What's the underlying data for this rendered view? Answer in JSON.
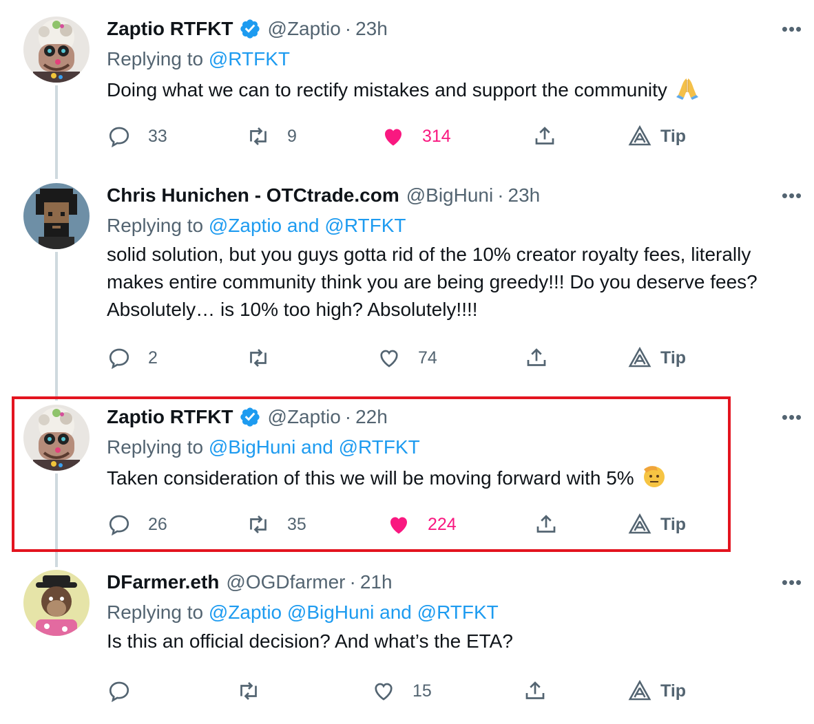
{
  "tweets": [
    {
      "name": "Zaptio RTFKT",
      "verified": true,
      "handle": "@Zaptio",
      "sep": "·",
      "time": "23h",
      "replying_prefix": "Replying to",
      "replying_to": "@RTFKT",
      "text": "Doing what we can to rectify mistakes and support the community",
      "emoji": "folded-hands",
      "replies": "33",
      "retweets": "9",
      "likes": "314",
      "liked": true,
      "tip": "Tip"
    },
    {
      "name": "Chris Hunichen - OTCtrade.com",
      "verified": false,
      "handle": "@BigHuni",
      "sep": "·",
      "time": "23h",
      "replying_prefix": "Replying to",
      "replying_to": "@Zaptio and @RTFKT",
      "text": "solid solution, but you guys gotta rid of the 10% creator royalty fees, literally makes entire community think you are being greedy!!! Do you deserve fees? Absolutely… is 10% too high? Absolutely!!!!",
      "replies": "2",
      "retweets": "",
      "likes": "74",
      "liked": false,
      "tip": "Tip"
    },
    {
      "name": "Zaptio RTFKT",
      "verified": true,
      "handle": "@Zaptio",
      "sep": "·",
      "time": "22h",
      "replying_prefix": "Replying to",
      "replying_to": "@BigHuni and @RTFKT",
      "text": "Taken consideration of this we will be moving forward with 5%",
      "emoji": "saluting-face",
      "replies": "26",
      "retweets": "35",
      "likes": "224",
      "liked": true,
      "tip": "Tip",
      "highlighted": true
    },
    {
      "name": "DFarmer.eth",
      "verified": false,
      "handle": "@OGDfarmer",
      "sep": "·",
      "time": "21h",
      "replying_prefix": "Replying to",
      "replying_to": "@Zaptio @BigHuni and @RTFKT",
      "text": "Is this an official decision? And what’s the ETA?",
      "replies": "",
      "retweets": "",
      "likes": "15",
      "liked": false,
      "tip": "Tip"
    }
  ],
  "more_label": "•••",
  "colors": {
    "accent": "#1d9bf0",
    "like": "#f91880",
    "muted": "#536471",
    "highlight": "#e3141f"
  }
}
